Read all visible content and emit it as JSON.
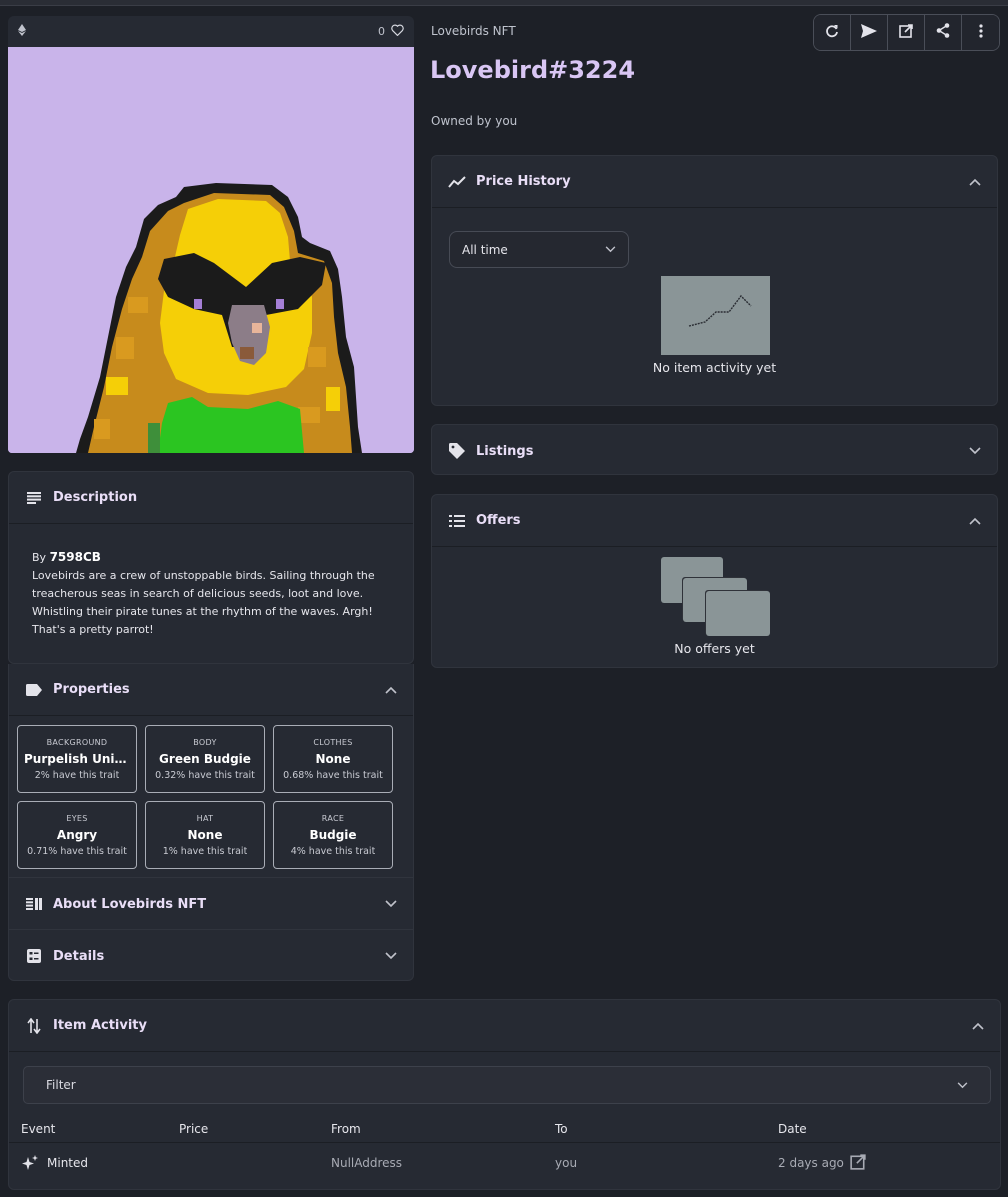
{
  "image": {
    "likes": "0",
    "pixel_colors": {
      "bg": "#c9b4ea",
      "outline": "#1b1b1b",
      "yellow": "#f5cf07",
      "ochre": "#c78b1c",
      "green": "#2bc521",
      "gray": "#8c7d88",
      "brown": "#8a5a3a"
    }
  },
  "header": {
    "collection": "Lovebirds NFT",
    "title": "Lovebird#3224",
    "owned_by": "Owned by you"
  },
  "actions": [
    "refresh-icon",
    "send-icon",
    "external-link-icon",
    "share-icon",
    "more-icon"
  ],
  "description": {
    "title": "Description",
    "by_prefix": "By",
    "creator": "7598CB",
    "text": "Lovebirds are a crew of unstoppable birds. Sailing through the treacherous seas in search of delicious seeds, loot and love. Whistling their pirate tunes at the rhythm of the waves. Argh! That's a pretty parrot!"
  },
  "properties": {
    "title": "Properties",
    "traits": [
      {
        "type": "BACKGROUND",
        "value": "Purpelish Unicorn",
        "rarity": "2% have this trait"
      },
      {
        "type": "BODY",
        "value": "Green Budgie",
        "rarity": "0.32% have this trait"
      },
      {
        "type": "CLOTHES",
        "value": "None",
        "rarity": "0.68% have this trait"
      },
      {
        "type": "EYES",
        "value": "Angry",
        "rarity": "0.71% have this trait"
      },
      {
        "type": "HAT",
        "value": "None",
        "rarity": "1% have this trait"
      },
      {
        "type": "RACE",
        "value": "Budgie",
        "rarity": "4% have this trait"
      }
    ]
  },
  "about": {
    "title": "About Lovebirds NFT"
  },
  "details": {
    "title": "Details"
  },
  "price_history": {
    "title": "Price History",
    "range": "All time",
    "empty": "No item activity yet"
  },
  "listings": {
    "title": "Listings"
  },
  "offers": {
    "title": "Offers",
    "empty": "No offers yet"
  },
  "activity": {
    "title": "Item Activity",
    "filter": "Filter",
    "columns": {
      "event": "Event",
      "price": "Price",
      "from": "From",
      "to": "To",
      "date": "Date"
    },
    "rows": [
      {
        "event": "Minted",
        "price": "",
        "from": "NullAddress",
        "to": "you",
        "date": "2 days ago"
      }
    ]
  }
}
